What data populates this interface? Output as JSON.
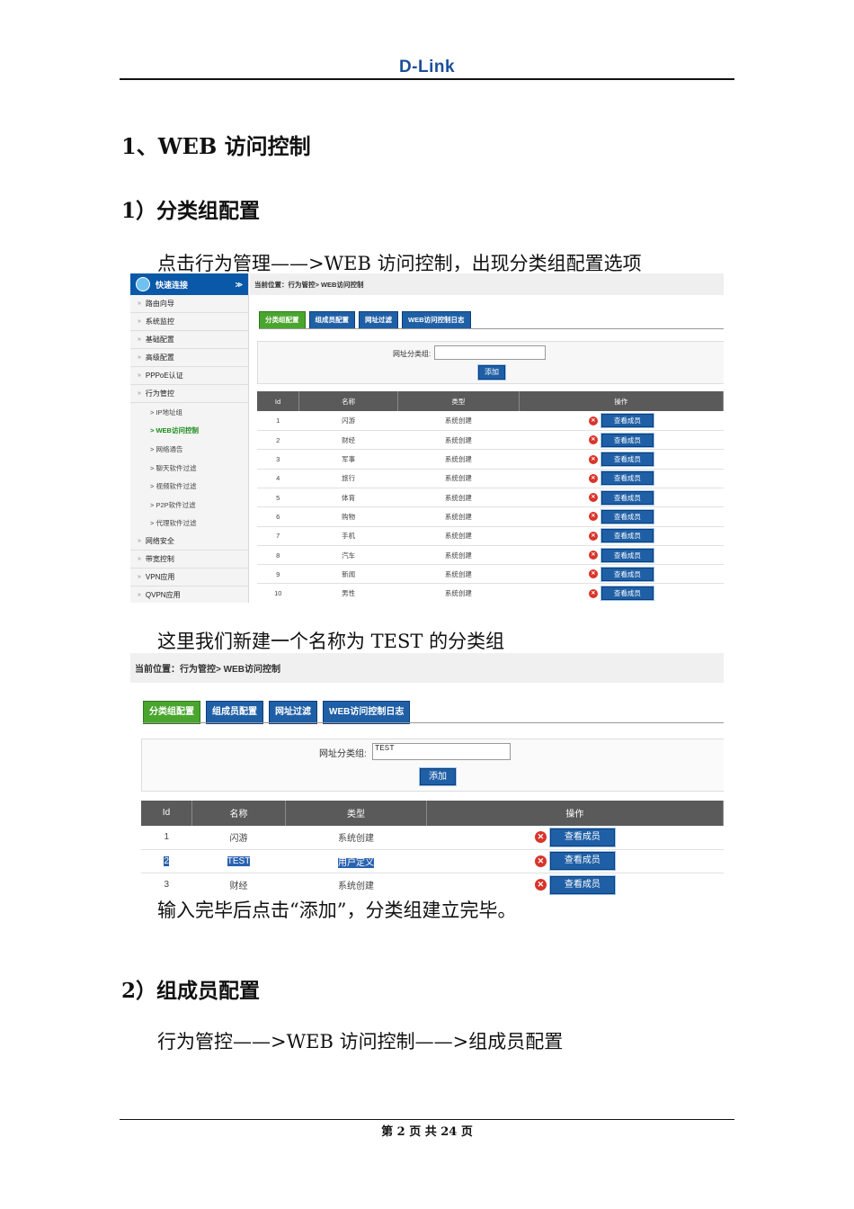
{
  "header": {
    "logo": "D-Link"
  },
  "heading1": "1、WEB 访问控制",
  "section1": {
    "title": "1）分类组配置",
    "intro": "点击行为管理——>WEB 访问控制，出现分类组配置选项",
    "after_shot": "这里我们新建一个名称为 TEST 的分类组",
    "after_shot2": "输入完毕后点击“添加”，分类组建立完毕。"
  },
  "section2": {
    "title": "2）组成员配置",
    "intro": "行为管控——>WEB 访问控制——>组成员配置"
  },
  "footer": "第 2 页 共 24 页",
  "shot1": {
    "sidebar_title": "快速连接",
    "menu": [
      "路由向导",
      "系统监控",
      "基础配置",
      "高级配置",
      "PPPoE认证",
      "行为管控"
    ],
    "submenu": [
      "> IP地址组",
      "> WEB访问控制",
      "> 网络通告",
      "> 聊天软件过滤",
      "> 视频软件过滤",
      "> P2P软件过滤",
      "> 代理软件过滤"
    ],
    "menu2": [
      "网络安全",
      "带宽控制",
      "VPN应用",
      "QVPN应用"
    ],
    "breadcrumb": "当前位置：行为管控> WEB访问控制",
    "tabs": [
      "分类组配置",
      "组成员配置",
      "网址过滤",
      "WEB访问控制日志"
    ],
    "field_label": "网址分类组:",
    "field_value": "",
    "add_button": "添加",
    "columns": [
      "Id",
      "名称",
      "类型",
      "操作"
    ],
    "rows": [
      {
        "id": "1",
        "name": "闪游",
        "type": "系统创建"
      },
      {
        "id": "2",
        "name": "财经",
        "type": "系统创建"
      },
      {
        "id": "3",
        "name": "军事",
        "type": "系统创建"
      },
      {
        "id": "4",
        "name": "旅行",
        "type": "系统创建"
      },
      {
        "id": "5",
        "name": "体育",
        "type": "系统创建"
      },
      {
        "id": "6",
        "name": "购物",
        "type": "系统创建"
      },
      {
        "id": "7",
        "name": "手机",
        "type": "系统创建"
      },
      {
        "id": "8",
        "name": "汽车",
        "type": "系统创建"
      },
      {
        "id": "9",
        "name": "新闻",
        "type": "系统创建"
      },
      {
        "id": "10",
        "name": "男性",
        "type": "系统创建"
      }
    ],
    "view_button": "查看成员"
  },
  "shot2": {
    "breadcrumb": "当前位置：行为管控> WEB访问控制",
    "tabs": [
      "分类组配置",
      "组成员配置",
      "网址过滤",
      "WEB访问控制日志"
    ],
    "field_label": "网址分类组:",
    "field_value": "TEST",
    "add_button": "添加",
    "columns": [
      "Id",
      "名称",
      "类型",
      "操作"
    ],
    "rows": [
      {
        "id": "1",
        "name": "闪游",
        "type": "系统创建"
      },
      {
        "id": "2",
        "name": "TEST",
        "type": "用户定义"
      },
      {
        "id": "3",
        "name": "财经",
        "type": "系统创建"
      }
    ],
    "view_button": "查看成员"
  }
}
